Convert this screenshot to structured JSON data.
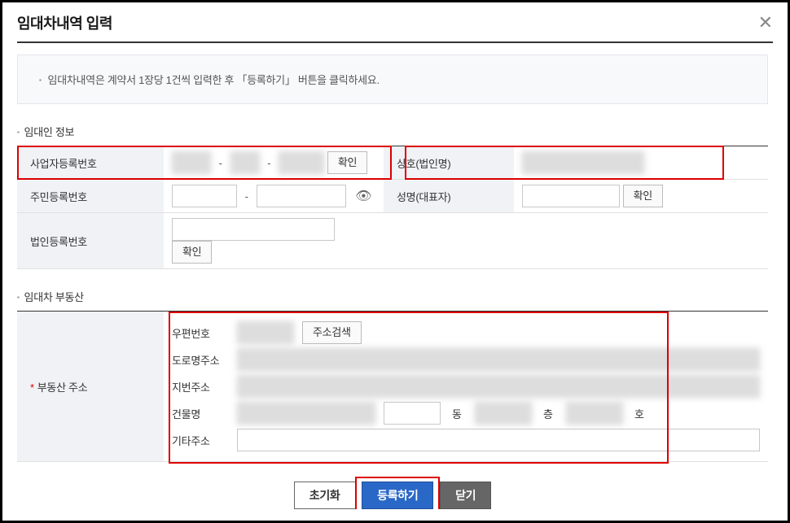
{
  "dialog": {
    "title": "임대차내역 입력",
    "close": "✕"
  },
  "notice": "임대차내역은 계약서 1장당 1건씩 입력한 후 「등록하기」 버튼을 클릭하세요.",
  "lessor": {
    "section": "임대인 정보",
    "biz_label": "사업자등록번호",
    "biz_a": "",
    "biz_b": "",
    "biz_c": "",
    "confirm": "확인",
    "company_label": "상호(법인명)",
    "company_val": "",
    "rrn_label": "주민등록번호",
    "rrn_a": "",
    "rrn_b": "",
    "name_label": "성명(대표자)",
    "name_val": "",
    "corp_label": "법인등록번호",
    "corp_val": ""
  },
  "property": {
    "section": "임대차 부동산",
    "addr_label": "부동산 주소",
    "zip_label": "우편번호",
    "zip_val": "",
    "search_btn": "주소검색",
    "road_label": "도로명주소",
    "road_val": "",
    "jibun_label": "지번주소",
    "jibun_val": "",
    "bldg_label": "건물명",
    "bldg_val": "",
    "dong_unit": "동",
    "dong_val": "",
    "floor_unit": "층",
    "floor_val": "",
    "ho_unit": "호",
    "ho_val": "",
    "etc_label": "기타주소",
    "etc_val": ""
  },
  "buttons": {
    "reset": "초기화",
    "submit": "등록하기",
    "close": "닫기"
  }
}
